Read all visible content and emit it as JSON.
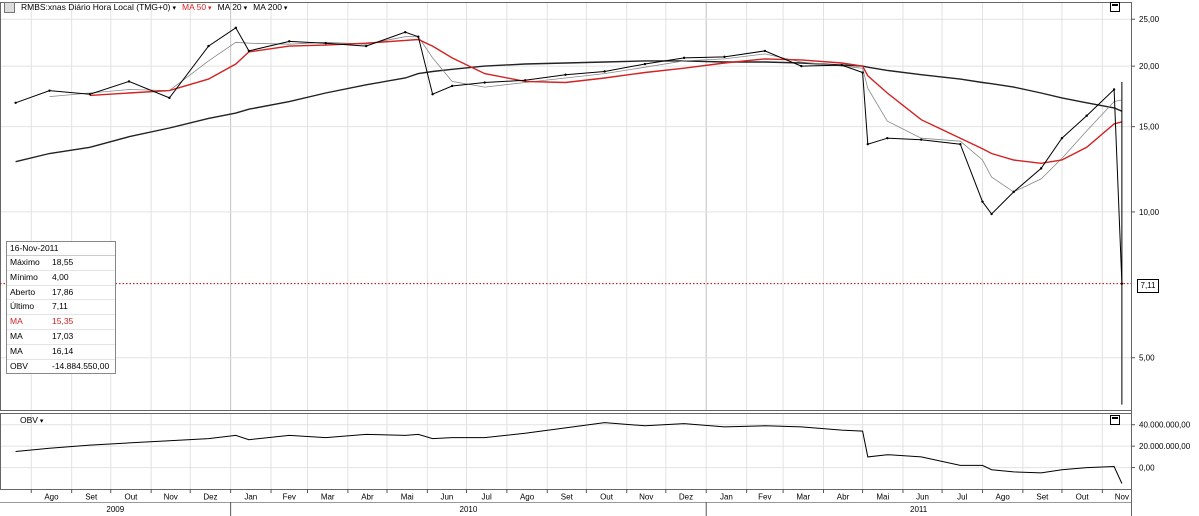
{
  "header": {
    "symbol": "RMBS:xnas Diário Hora Local (TMG+0)",
    "ma50_label": "MA 50",
    "ma20_label": "MA 20",
    "ma200_label": "MA 200"
  },
  "legend_box": {
    "date": "16-Nov-2011",
    "rows": [
      {
        "label": "Máximo",
        "value": "18,55",
        "color": "#000000"
      },
      {
        "label": "Mínimo",
        "value": "4,00",
        "color": "#000000"
      },
      {
        "label": "Aberto",
        "value": "17,86",
        "color": "#000000"
      },
      {
        "label": "Último",
        "value": "7,11",
        "color": "#000000"
      },
      {
        "label": "MA",
        "value": "15,35",
        "color": "#d22222"
      },
      {
        "label": "MA",
        "value": "17,03",
        "color": "#000000"
      },
      {
        "label": "MA",
        "value": "16,14",
        "color": "#000000"
      },
      {
        "label": "OBV",
        "value": "-14.884.550,00",
        "color": "#000000"
      }
    ]
  },
  "last_price_label": "7,11",
  "obv_panel": {
    "label": "OBV"
  },
  "colors": {
    "price": "#000000",
    "ma50": "#d22222",
    "ma20": "#888888",
    "ma200": "#222222",
    "last_line": "#c00000"
  },
  "chart_data": [
    {
      "type": "line",
      "title": "RMBS:xnas Diário Hora Local (TMG+0)",
      "scale": "log",
      "y_ticks": [
        "25,00",
        "20,00",
        "15,00",
        "10,00",
        "5,00"
      ],
      "x_month_ticks": [
        "Ago",
        "Set",
        "Out",
        "Nov",
        "Dez",
        "Jan",
        "Fev",
        "Mar",
        "Abr",
        "Mai",
        "Jun",
        "Jul",
        "Ago",
        "Set",
        "Out",
        "Nov",
        "Dez",
        "Jan",
        "Fev",
        "Mar",
        "Abr",
        "Mai",
        "Jun",
        "Jul",
        "Ago",
        "Set",
        "Out",
        "Nov"
      ],
      "x_year_ticks": [
        "2009",
        "2010",
        "2011"
      ],
      "x": [
        "2009-07-20",
        "2009-08-15",
        "2009-09-15",
        "2009-10-15",
        "2009-11-15",
        "2009-12-15",
        "2010-01-05",
        "2010-01-15",
        "2010-02-15",
        "2010-03-15",
        "2010-04-15",
        "2010-05-15",
        "2010-05-25",
        "2010-06-05",
        "2010-06-20",
        "2010-07-15",
        "2010-08-15",
        "2010-09-15",
        "2010-10-15",
        "2010-11-15",
        "2010-12-15",
        "2011-01-15",
        "2011-02-15",
        "2011-03-15",
        "2011-04-15",
        "2011-05-01",
        "2011-05-05",
        "2011-05-20",
        "2011-06-15",
        "2011-07-15",
        "2011-08-01",
        "2011-08-08",
        "2011-08-25",
        "2011-09-15",
        "2011-10-01",
        "2011-10-20",
        "2011-11-10",
        "2011-11-16"
      ],
      "series": [
        {
          "name": "",
          "values": [
            16.8,
            17.8,
            17.5,
            18.6,
            17.2,
            22.0,
            24.0,
            21.5,
            22.5,
            22.3,
            22.0,
            23.5,
            23.0,
            17.5,
            18.2,
            18.5,
            18.7,
            19.2,
            19.5,
            20.2,
            20.8,
            20.9,
            21.5,
            20.0,
            20.1,
            19.4,
            13.8,
            14.2,
            14.1,
            13.8,
            10.5,
            9.9,
            11.0,
            12.3,
            14.2,
            15.8,
            17.9,
            7.11
          ]
        },
        {
          "name": "MA 50",
          "values": [
            null,
            null,
            17.4,
            17.6,
            17.8,
            18.8,
            20.2,
            21.4,
            22.0,
            22.1,
            22.3,
            22.6,
            22.7,
            22.0,
            20.8,
            19.3,
            18.6,
            18.5,
            18.9,
            19.4,
            19.8,
            20.3,
            20.7,
            20.6,
            20.3,
            20.0,
            19.1,
            17.6,
            15.5,
            14.2,
            13.5,
            13.2,
            12.8,
            12.6,
            12.8,
            13.6,
            15.2,
            15.35
          ]
        },
        {
          "name": "MA 20",
          "values": [
            null,
            17.3,
            17.6,
            17.9,
            17.8,
            20.5,
            22.4,
            22.3,
            22.2,
            22.4,
            22.2,
            23.0,
            23.0,
            20.8,
            18.6,
            18.1,
            18.5,
            18.9,
            19.3,
            19.9,
            20.5,
            20.7,
            21.2,
            20.4,
            20.0,
            19.8,
            18.0,
            15.4,
            14.2,
            14.0,
            12.8,
            11.8,
            11.0,
            11.7,
            12.9,
            14.7,
            16.9,
            17.03
          ]
        },
        {
          "name": "MA 200",
          "values": [
            12.7,
            13.2,
            13.6,
            14.3,
            14.9,
            15.6,
            16.0,
            16.3,
            16.9,
            17.6,
            18.3,
            18.9,
            19.3,
            19.5,
            19.7,
            20.0,
            20.2,
            20.3,
            20.4,
            20.5,
            20.5,
            20.4,
            20.4,
            20.3,
            20.1,
            20.0,
            19.9,
            19.6,
            19.2,
            18.8,
            18.5,
            18.4,
            18.1,
            17.6,
            17.2,
            16.8,
            16.4,
            16.14
          ]
        }
      ]
    },
    {
      "type": "line",
      "title": "OBV",
      "y_ticks": [
        "40.000.000,00",
        "20.000.000,00",
        "0,00"
      ],
      "x": [
        "2009-07-20",
        "2009-08-15",
        "2009-09-15",
        "2009-10-15",
        "2009-11-15",
        "2009-12-15",
        "2010-01-05",
        "2010-01-15",
        "2010-02-15",
        "2010-03-15",
        "2010-04-15",
        "2010-05-15",
        "2010-05-25",
        "2010-06-05",
        "2010-06-20",
        "2010-07-15",
        "2010-08-15",
        "2010-09-15",
        "2010-10-15",
        "2010-11-15",
        "2010-12-15",
        "2011-01-15",
        "2011-02-15",
        "2011-03-15",
        "2011-04-15",
        "2011-05-01",
        "2011-05-05",
        "2011-05-20",
        "2011-06-15",
        "2011-07-15",
        "2011-08-01",
        "2011-08-08",
        "2011-08-25",
        "2011-09-15",
        "2011-10-01",
        "2011-10-20",
        "2011-11-10",
        "2011-11-16"
      ],
      "series": [
        {
          "name": "OBV",
          "values": [
            15000000,
            18000000,
            21000000,
            23000000,
            25000000,
            27000000,
            30000000,
            26000000,
            30000000,
            28000000,
            31000000,
            30000000,
            31000000,
            27000000,
            28000000,
            28000000,
            32000000,
            37000000,
            42000000,
            39000000,
            41000000,
            38000000,
            39000000,
            38000000,
            35000000,
            34000000,
            10000000,
            12000000,
            10000000,
            2000000,
            2000000,
            -2000000,
            -4000000,
            -5000000,
            -2000000,
            0,
            1000000,
            -14884550
          ]
        }
      ]
    }
  ]
}
